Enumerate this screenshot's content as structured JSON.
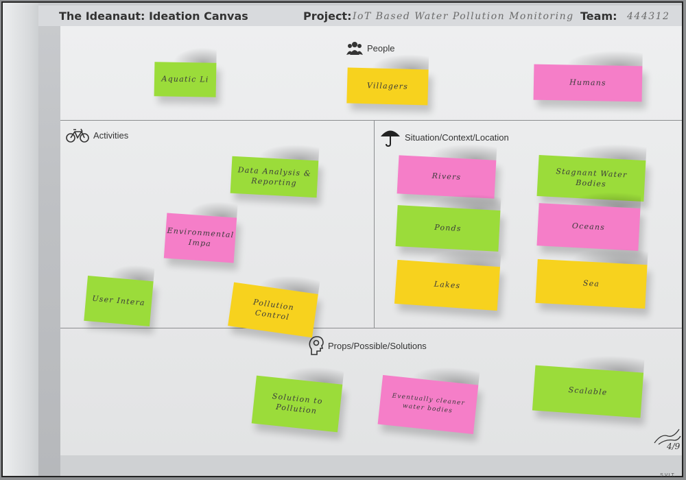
{
  "header": {
    "title": "The Ideanaut: Ideation Canvas",
    "project_label": "Project:",
    "project_value": "IoT Based Water Pollution Monitoring",
    "team_label": "Team:",
    "team_value": "444312"
  },
  "sections": {
    "people": "People",
    "activities": "Activities",
    "situation": "Situation/Context/Location",
    "props": "Props/Possible/Solutions"
  },
  "notes": {
    "people": [
      "Aquatic Li",
      "Villagers",
      "Humans"
    ],
    "activities": [
      "Data Analysis & Reporting",
      "Environmental Impa",
      "User Intera",
      "Pollution Control"
    ],
    "situation": [
      "Rivers",
      "Stagnant Water Bodies",
      "Ponds",
      "Oceans",
      "Lakes",
      "Sea"
    ],
    "props": [
      "Solution to Pollution",
      "Eventually cleaner water bodies",
      "Scalable"
    ]
  },
  "signature_date": "4/9",
  "footer_mark": "S.V.I.T.",
  "colors": {
    "green": "#9bdc3a",
    "yellow": "#f7d21e",
    "pink": "#f57ec8"
  }
}
